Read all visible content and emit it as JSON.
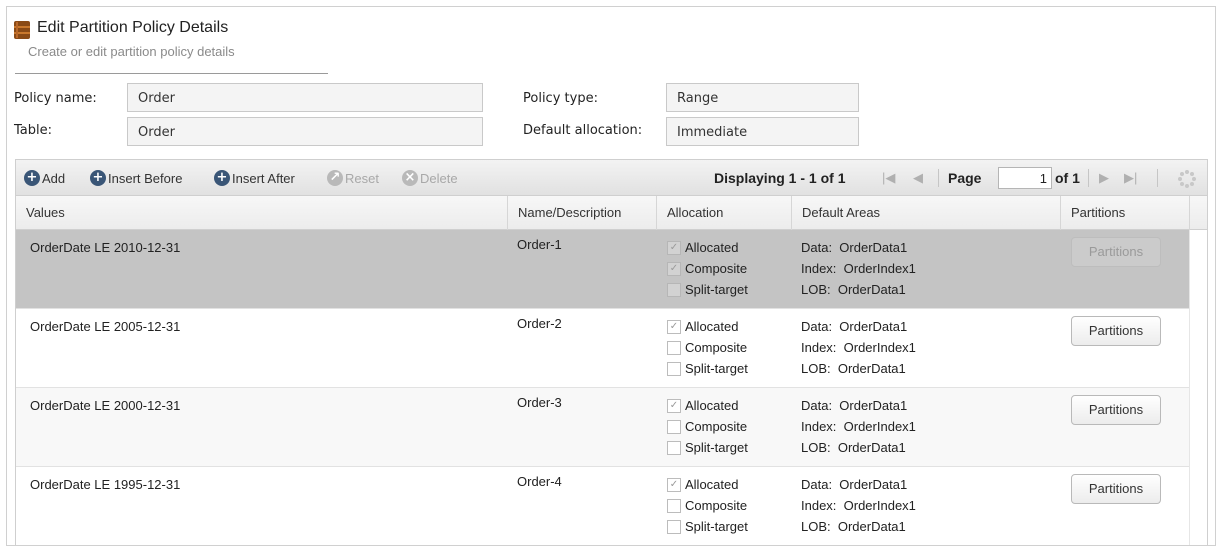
{
  "header": {
    "title": "Edit Partition Policy Details",
    "subtitle": "Create or edit partition policy details"
  },
  "form": {
    "policy_name_label": "Policy name:",
    "policy_name_value": "Order",
    "table_label": "Table:",
    "table_value": "Order",
    "policy_type_label": "Policy type:",
    "policy_type_value": "Range",
    "default_allocation_label": "Default allocation:",
    "default_allocation_value": "Immediate"
  },
  "toolbar": {
    "add": "Add",
    "insert_before": "Insert Before",
    "insert_after": "Insert After",
    "reset": "Reset",
    "delete": "Delete"
  },
  "paging": {
    "displaying": "Displaying 1 - 1 of 1",
    "page_label": "Page",
    "page_value": "1",
    "of_label": "of 1"
  },
  "columns": [
    "Values",
    "Name/Description",
    "Allocation",
    "Default Areas",
    "Partitions"
  ],
  "rows": [
    {
      "values": "OrderDate LE  2010-12-31",
      "name": "Order-1",
      "allocation": [
        {
          "label": "Allocated",
          "checked": true
        },
        {
          "label": "Composite",
          "checked": true
        },
        {
          "label": "Split-target",
          "checked": false
        }
      ],
      "areas": [
        "Data:  OrderData1",
        "Index:  OrderIndex1",
        "LOB:  OrderData1"
      ],
      "button": "Partitions",
      "selected": true
    },
    {
      "values": "OrderDate LE  2005-12-31",
      "name": "Order-2",
      "allocation": [
        {
          "label": "Allocated",
          "checked": true
        },
        {
          "label": "Composite",
          "checked": false
        },
        {
          "label": "Split-target",
          "checked": false
        }
      ],
      "areas": [
        "Data:  OrderData1",
        "Index:  OrderIndex1",
        "LOB:  OrderData1"
      ],
      "button": "Partitions",
      "selected": false
    },
    {
      "values": "OrderDate LE  2000-12-31",
      "name": "Order-3",
      "allocation": [
        {
          "label": "Allocated",
          "checked": true
        },
        {
          "label": "Composite",
          "checked": false
        },
        {
          "label": "Split-target",
          "checked": false
        }
      ],
      "areas": [
        "Data:  OrderData1",
        "Index:  OrderIndex1",
        "LOB:  OrderData1"
      ],
      "button": "Partitions",
      "selected": false
    },
    {
      "values": "OrderDate LE  1995-12-31",
      "name": "Order-4",
      "allocation": [
        {
          "label": "Allocated",
          "checked": true
        },
        {
          "label": "Composite",
          "checked": false
        },
        {
          "label": "Split-target",
          "checked": false
        }
      ],
      "areas": [
        "Data:  OrderData1",
        "Index:  OrderIndex1",
        "LOB:  OrderData1"
      ],
      "button": "Partitions",
      "selected": false
    }
  ],
  "colors": {
    "selected_row": "#c4c4c4",
    "toolbar_icon": "#3a5677",
    "disabled": "#a8a8a8"
  },
  "icons": {
    "header": "database-icon",
    "add": "plus-circle-icon",
    "reset": "reset-icon",
    "delete": "close-circle-icon",
    "refresh": "loading-icon"
  }
}
